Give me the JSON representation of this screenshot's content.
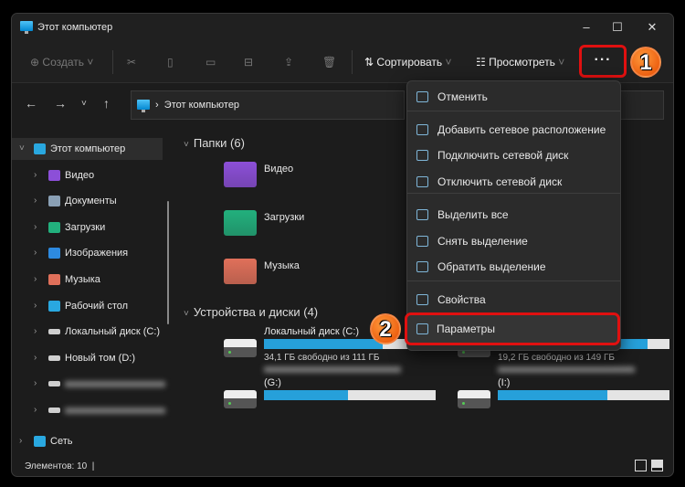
{
  "window": {
    "title": "Этот компьютер",
    "minimize": "–",
    "maximize": "☐",
    "close": "✕"
  },
  "toolbar": {
    "create": "Создать",
    "sort": "Сортировать",
    "view": "Просмотреть",
    "more": "···",
    "icons": [
      "cut-icon",
      "copy-icon",
      "paste-icon",
      "rename-icon",
      "share-icon",
      "delete-icon"
    ]
  },
  "annotations": {
    "step1": "1",
    "step2": "2",
    "highlight_color": "#e01010",
    "badge_color": "#f26b1d"
  },
  "address": {
    "path": "Этот компьютер",
    "separator": "›"
  },
  "sidebar": {
    "items": [
      {
        "label": "Этот компьютер",
        "icon": "pc-icon",
        "color": "#29a8e0"
      },
      {
        "label": "Видео",
        "icon": "video-icon",
        "color": "#8c4fd8"
      },
      {
        "label": "Документы",
        "icon": "documents-icon",
        "color": "#8aa0b5"
      },
      {
        "label": "Загрузки",
        "icon": "downloads-icon",
        "color": "#22b07d"
      },
      {
        "label": "Изображения",
        "icon": "pictures-icon",
        "color": "#2d8ae0"
      },
      {
        "label": "Музыка",
        "icon": "music-icon",
        "color": "#e0705a"
      },
      {
        "label": "Рабочий стол",
        "icon": "desktop-icon",
        "color": "#29a8e0"
      },
      {
        "label": "Локальный диск (C:)",
        "icon": "drive-icon",
        "color": "#cfcfcf"
      },
      {
        "label": "Новый том (D:)",
        "icon": "drive-icon",
        "color": "#cfcfcf"
      },
      {
        "label": "",
        "icon": "drive-icon",
        "color": "#cfcfcf",
        "blurred": true
      },
      {
        "label": "",
        "icon": "drive-icon",
        "color": "#cfcfcf",
        "blurred": true
      },
      {
        "label": "Сеть",
        "icon": "network-icon",
        "color": "#29a8e0"
      }
    ]
  },
  "content": {
    "folders_header": "Папки (6)",
    "folders": [
      {
        "name": "Видео",
        "color": "#8c4fd8"
      },
      {
        "name": "Загрузки",
        "color": "#22b07d"
      },
      {
        "name": "Музыка",
        "color": "#e0705a"
      }
    ],
    "drives_header": "Устройства и диски (4)",
    "drives": [
      {
        "name": "Локальный диск (C:)",
        "free": "34,1 ГБ свободно из 111 ГБ",
        "used_percent": 69
      },
      {
        "name": "",
        "free": "19,2 ГБ свободно из 149 ГБ",
        "used_percent": 87
      },
      {
        "name": "(G:)",
        "free": "",
        "used_percent": 49,
        "blurred_title": true
      },
      {
        "name": "(I:)",
        "free": "",
        "used_percent": 64,
        "blurred_title": true
      }
    ]
  },
  "menu": {
    "items": [
      {
        "label": "Отменить",
        "icon": "undo-icon"
      },
      {
        "label": "Добавить сетевое расположение",
        "icon": "add-network-location-icon"
      },
      {
        "label": "Подключить сетевой диск",
        "icon": "map-network-drive-icon"
      },
      {
        "label": "Отключить сетевой диск",
        "icon": "disconnect-network-drive-icon"
      },
      {
        "label": "Выделить все",
        "icon": "select-all-icon"
      },
      {
        "label": "Снять выделение",
        "icon": "select-none-icon"
      },
      {
        "label": "Обратить выделение",
        "icon": "invert-selection-icon"
      },
      {
        "label": "Свойства",
        "icon": "properties-icon"
      },
      {
        "label": "Параметры",
        "icon": "folder-options-icon"
      }
    ]
  },
  "status": {
    "items": "Элементов: 10"
  }
}
